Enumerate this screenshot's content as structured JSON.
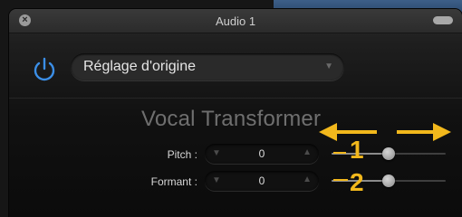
{
  "window": {
    "title": "Audio 1"
  },
  "preset": {
    "label": "Réglage d'origine"
  },
  "plugin": {
    "name": "Vocal Transformer"
  },
  "params": {
    "pitch": {
      "label": "Pitch :",
      "value": "0",
      "slider_level": 0.5
    },
    "formant": {
      "label": "Formant :",
      "value": "0",
      "slider_level": 0.5
    }
  },
  "annotations": {
    "one": "1",
    "two": "2",
    "color": "#f2b81c"
  },
  "icons": {
    "close": "close-icon",
    "collapse": "collapse-icon",
    "power": "power-icon",
    "dropdown": "chevron-down-icon"
  },
  "colors": {
    "power_accent": "#3b8ee6",
    "annotation": "#f2b81c"
  }
}
